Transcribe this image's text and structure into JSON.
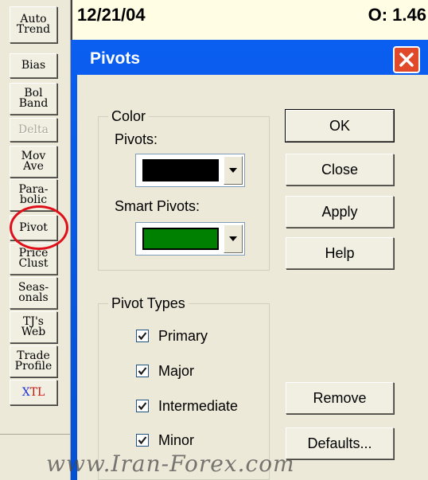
{
  "toolbar": {
    "buttons": [
      {
        "label": "Auto\nTrend"
      },
      {
        "label": "Bias"
      },
      {
        "label": "Bol\nBand"
      },
      {
        "label": "Delta"
      },
      {
        "label": "Mov\nAve"
      },
      {
        "label": "Para-\nbolic"
      },
      {
        "label": "Pivot"
      },
      {
        "label": "Price\nClust"
      },
      {
        "label": "Seas-\nonals"
      },
      {
        "label": "TJ's\nWeb"
      },
      {
        "label": "Trade\nProfile"
      },
      {
        "label_x": "X",
        "label_tl": "TL"
      }
    ]
  },
  "strip": {
    "date": "12/21/04",
    "open": "O: 1.46"
  },
  "dialog": {
    "title": "Pivots",
    "color_group": {
      "title": "Color",
      "pivots_label": "Pivots:",
      "pivots_color": "#000000",
      "smart_label": "Smart Pivots:",
      "smart_color": "#008000"
    },
    "types_group": {
      "title": "Pivot Types",
      "items": [
        {
          "label": "Primary",
          "checked": true
        },
        {
          "label": "Major",
          "checked": true
        },
        {
          "label": "Intermediate",
          "checked": true
        },
        {
          "label": "Minor",
          "checked": true
        }
      ]
    },
    "buttons": {
      "ok": "OK",
      "close": "Close",
      "apply": "Apply",
      "help": "Help",
      "remove": "Remove",
      "defaults": "Defaults..."
    }
  },
  "watermark": "www.Iran-Forex.com",
  "colors": {
    "title_bar": "#0a5ef0",
    "close_button": "#e04a2a",
    "highlight_ring": "#e0101a"
  }
}
